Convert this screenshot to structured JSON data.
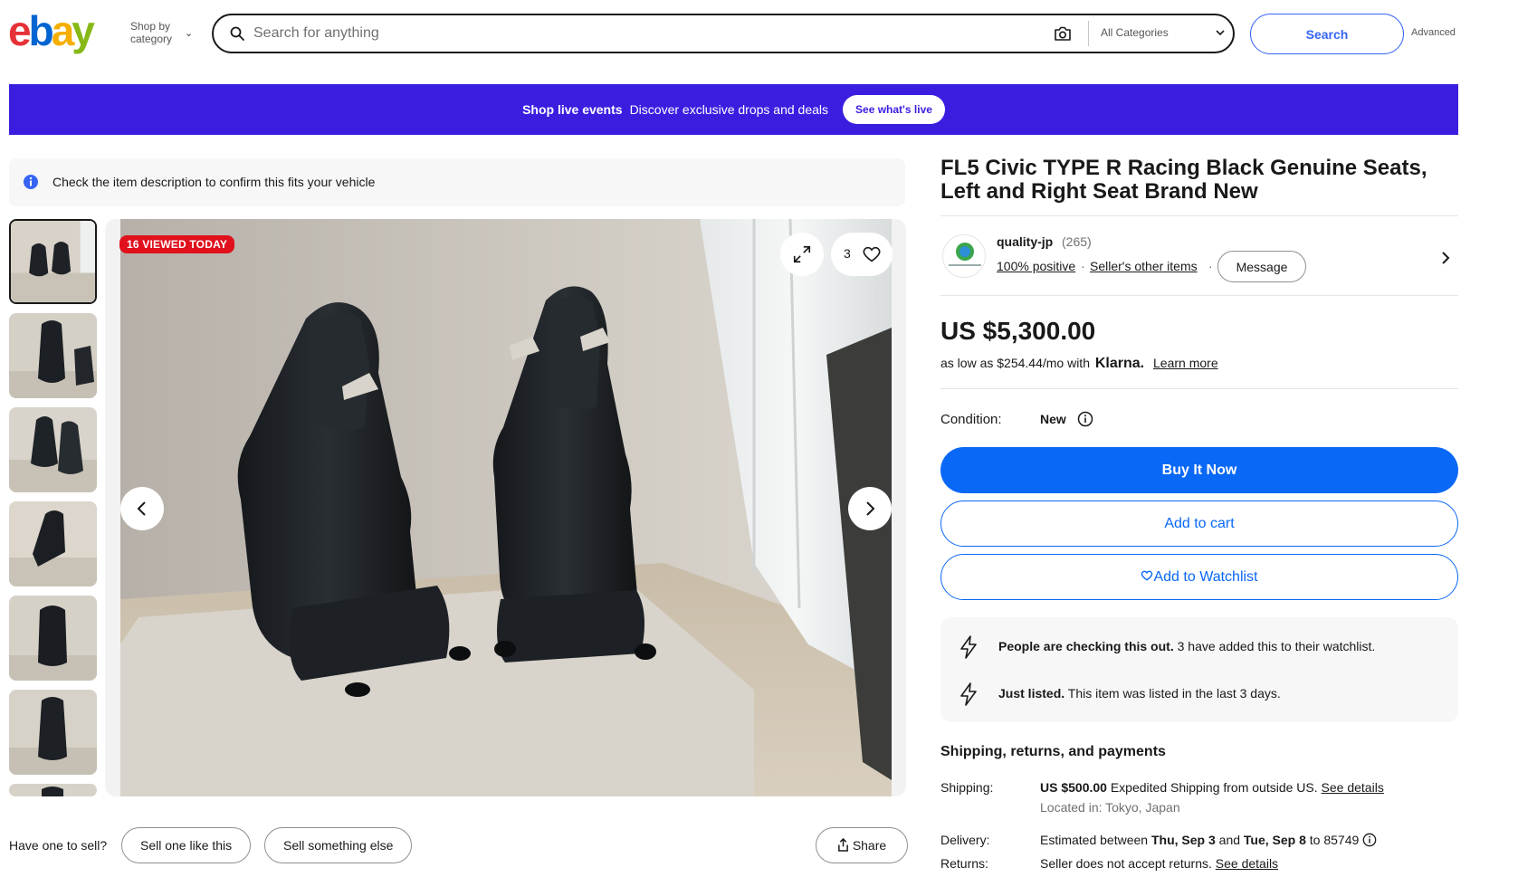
{
  "header": {
    "logo_letters": [
      "e",
      "b",
      "a",
      "y"
    ],
    "shop_by_category": "Shop by category",
    "search_placeholder": "Search for anything",
    "category_select": "All Categories",
    "search_button": "Search",
    "advanced_link": "Advanced"
  },
  "banner": {
    "strong": "Shop live events",
    "text": "Discover exclusive drops and deals",
    "button": "See what's live"
  },
  "notice": {
    "text": "Check the item description to confirm this fits your vehicle"
  },
  "gallery": {
    "viewed_badge": "16 VIEWED TODAY",
    "watch_count": "3",
    "thumbnail_count": 7,
    "selected_thumbnail": 1
  },
  "sell": {
    "label": "Have one to sell?",
    "sell_like_this": "Sell one like this",
    "sell_something_else": "Sell something else",
    "share": "Share"
  },
  "item": {
    "title": "FL5 Civic TYPE R Racing Black Genuine Seats, Left and Right Seat Brand New",
    "seller_name": "quality-jp",
    "seller_feedback_count": "(265)",
    "seller_positive": "100% positive",
    "seller_other_items": "Seller's other items",
    "message_button": "Message",
    "price": "US $5,300.00",
    "klarna_prefix": "as low as $254.44/mo with",
    "klarna_brand": "Klarna.",
    "klarna_learn_more": "Learn more",
    "condition_label": "Condition:",
    "condition_value": "New",
    "buy_it_now": "Buy It Now",
    "add_to_cart": "Add to cart",
    "add_to_watchlist": "Add to Watchlist"
  },
  "signals": [
    {
      "strong": "People are checking this out.",
      "text": "3 have added this to their watchlist."
    },
    {
      "strong": "Just listed.",
      "text": "This item was listed in the last 3 days."
    }
  ],
  "shipping": {
    "heading": "Shipping, returns, and payments",
    "shipping_label": "Shipping:",
    "shipping_price": "US $500.00",
    "shipping_method": "Expedited Shipping from outside US.",
    "shipping_details_link": "See details",
    "located_in": "Located in: Tokyo, Japan",
    "delivery_label": "Delivery:",
    "delivery_prefix": "Estimated between",
    "delivery_start": "Thu, Sep 3",
    "delivery_and": "and",
    "delivery_end": "Tue, Sep 8",
    "delivery_to": "to 85749",
    "returns_label": "Returns:",
    "returns_text": "Seller does not accept returns.",
    "returns_details_link": "See details"
  },
  "colors": {
    "primary_blue": "#0968f6",
    "banner_purple": "#3a1ee0",
    "badge_red": "#e0101c"
  }
}
